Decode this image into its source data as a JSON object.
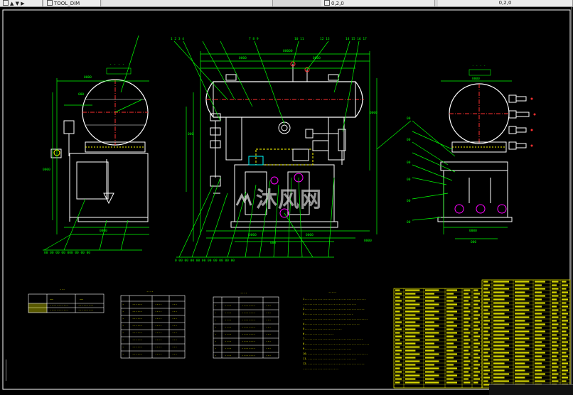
{
  "tabs": [
    {
      "label": "▲ ▼ ▶"
    },
    {
      "label": "TOOL_DIM"
    },
    {
      "label": "0,2,0"
    },
    {
      "label": "0,2,0"
    }
  ],
  "watermark": {
    "text": "沐风网"
  },
  "colors": {
    "background": "#000000",
    "frame": "#ffffff",
    "geometry": "#ffffff",
    "dimension": "#00ff00",
    "tables": "#ffff00",
    "leaders": "#00ff00",
    "accent_red": "#ff3030",
    "accent_cyan": "#00ffff",
    "accent_magenta": "#ff00ff"
  },
  "views": [
    {
      "name": "side-view-left"
    },
    {
      "name": "front-view"
    },
    {
      "name": "side-view-right"
    }
  ]
}
